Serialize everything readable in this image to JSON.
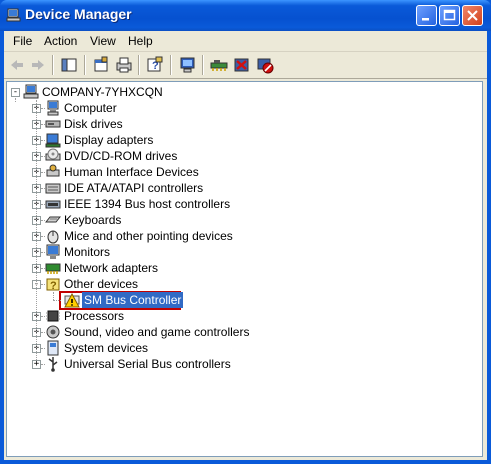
{
  "window": {
    "title": "Device Manager"
  },
  "menu": {
    "items": [
      "File",
      "Action",
      "View",
      "Help"
    ]
  },
  "tree": {
    "root": "COMPANY-7YHXCQN",
    "categories": [
      {
        "label": "Computer",
        "icon": "computer-icon"
      },
      {
        "label": "Disk drives",
        "icon": "disk-drive-icon"
      },
      {
        "label": "Display adapters",
        "icon": "display-adapter-icon"
      },
      {
        "label": "DVD/CD-ROM drives",
        "icon": "cdrom-icon"
      },
      {
        "label": "Human Interface Devices",
        "icon": "hid-icon"
      },
      {
        "label": "IDE ATA/ATAPI controllers",
        "icon": "ide-controller-icon"
      },
      {
        "label": "IEEE 1394 Bus host controllers",
        "icon": "ieee1394-icon"
      },
      {
        "label": "Keyboards",
        "icon": "keyboard-icon"
      },
      {
        "label": "Mice and other pointing devices",
        "icon": "mouse-icon"
      },
      {
        "label": "Monitors",
        "icon": "monitor-icon"
      },
      {
        "label": "Network adapters",
        "icon": "network-adapter-icon"
      },
      {
        "label": "Other devices",
        "icon": "unknown-device-icon",
        "expanded": true
      },
      {
        "label": "Processors",
        "icon": "processor-icon"
      },
      {
        "label": "Sound, video and game controllers",
        "icon": "sound-icon"
      },
      {
        "label": "System devices",
        "icon": "system-device-icon"
      },
      {
        "label": "Universal Serial Bus controllers",
        "icon": "usb-icon"
      }
    ],
    "selected_child": {
      "label": "SM Bus Controller",
      "icon": "warning-device-icon"
    }
  },
  "colors": {
    "selection": "#316ac5",
    "highlight_border": "#c00000",
    "titlebar": "#0a5ad9"
  }
}
